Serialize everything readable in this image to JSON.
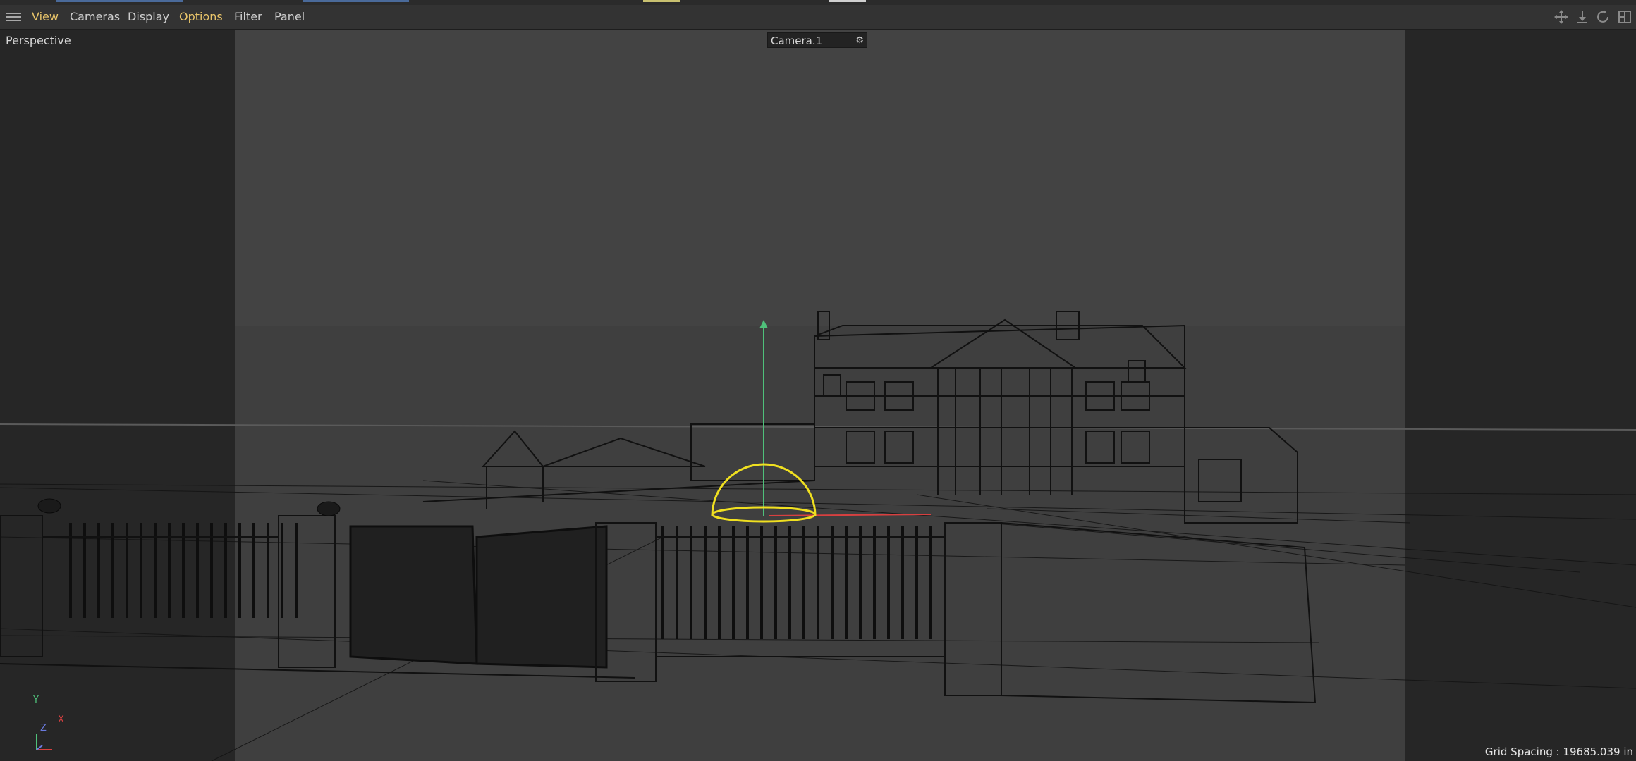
{
  "menubar": {
    "items": [
      {
        "label": "View"
      },
      {
        "label": "Cameras"
      },
      {
        "label": "Display"
      },
      {
        "label": "Options"
      },
      {
        "label": "Filter"
      },
      {
        "label": "Panel"
      }
    ],
    "nav_icons": [
      "move-view-icon",
      "zoom-view-icon",
      "rotate-view-icon",
      "toggle-views-icon"
    ]
  },
  "viewport": {
    "projection_label": "Perspective",
    "camera_name": "Camera.1",
    "grid_spacing": "Grid Spacing : 19685.039 in",
    "axis": {
      "y": "Y",
      "z": "Z",
      "x": "X"
    }
  },
  "colors": {
    "highlight_menu": "#e9c56a",
    "selected_object": "#f0e020",
    "y_axis": "#4fc07a",
    "x_axis": "#d84040"
  }
}
